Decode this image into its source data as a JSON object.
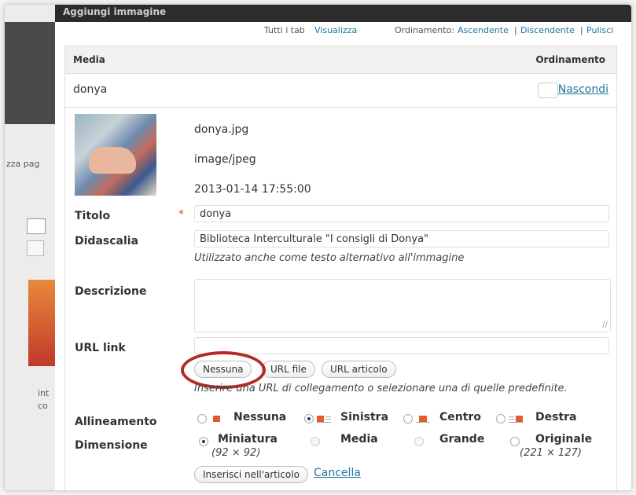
{
  "window": {
    "title": "Aggiungi immagine"
  },
  "sidebar": {
    "fragment_text": "zza pag",
    "side_text_1": "int",
    "side_text_2": "co"
  },
  "toolbar": {
    "tabs_label": "Tutti i tab",
    "show_link": "Visualizza",
    "sort_label": "Ordinamento:",
    "ascending": "Ascendente",
    "descending": "Discendente",
    "clean": "Pulisci",
    "sep": "|"
  },
  "table": {
    "col_media": "Media",
    "col_order": "Ordinamento"
  },
  "item": {
    "name": "donya",
    "hide_label": "Nascondi",
    "filename": "donya.jpg",
    "mimetype": "image/jpeg",
    "date": "2013-01-14 17:55:00"
  },
  "form": {
    "title_label": "Titolo",
    "required_mark": "*",
    "title_value": "donya",
    "caption_label": "Didascalia",
    "caption_value": "Biblioteca Interculturale \"I consigli di Donya\"",
    "caption_help": "Utilizzato anche come testo alternativo all'immagine",
    "description_label": "Descrizione",
    "description_value": "",
    "url_label": "URL link",
    "url_value": "",
    "btn_none": "Nessuna",
    "btn_file": "URL file",
    "btn_post": "URL articolo",
    "url_help": "Inserire una URL di collegamento o selezionare una di quelle predefinite.",
    "align_label": "Allineamento",
    "align_options": [
      "Nessuna",
      "Sinistra",
      "Centro",
      "Destra"
    ],
    "align_selected": "Sinistra",
    "size_label": "Dimensione",
    "size_options": [
      "Miniatura",
      "Media",
      "Grande",
      "Originale"
    ],
    "size_selected": "Miniatura",
    "size_thumb_dims": "(92 × 92)",
    "size_orig_dims": "(221 × 127)",
    "insert_button": "Inserisci nell'articolo",
    "cancel_link": "Cancella",
    "textarea_grip": "//"
  },
  "colors": {
    "accent_link": "#21759b",
    "highlight_circle": "#b32a24",
    "required": "#d54e21"
  },
  "icons": {
    "align_none": "align-none-icon",
    "align_left": "align-left-icon",
    "align_center": "align-center-icon",
    "align_right": "align-right-icon",
    "resize": "resize-grip-icon"
  }
}
